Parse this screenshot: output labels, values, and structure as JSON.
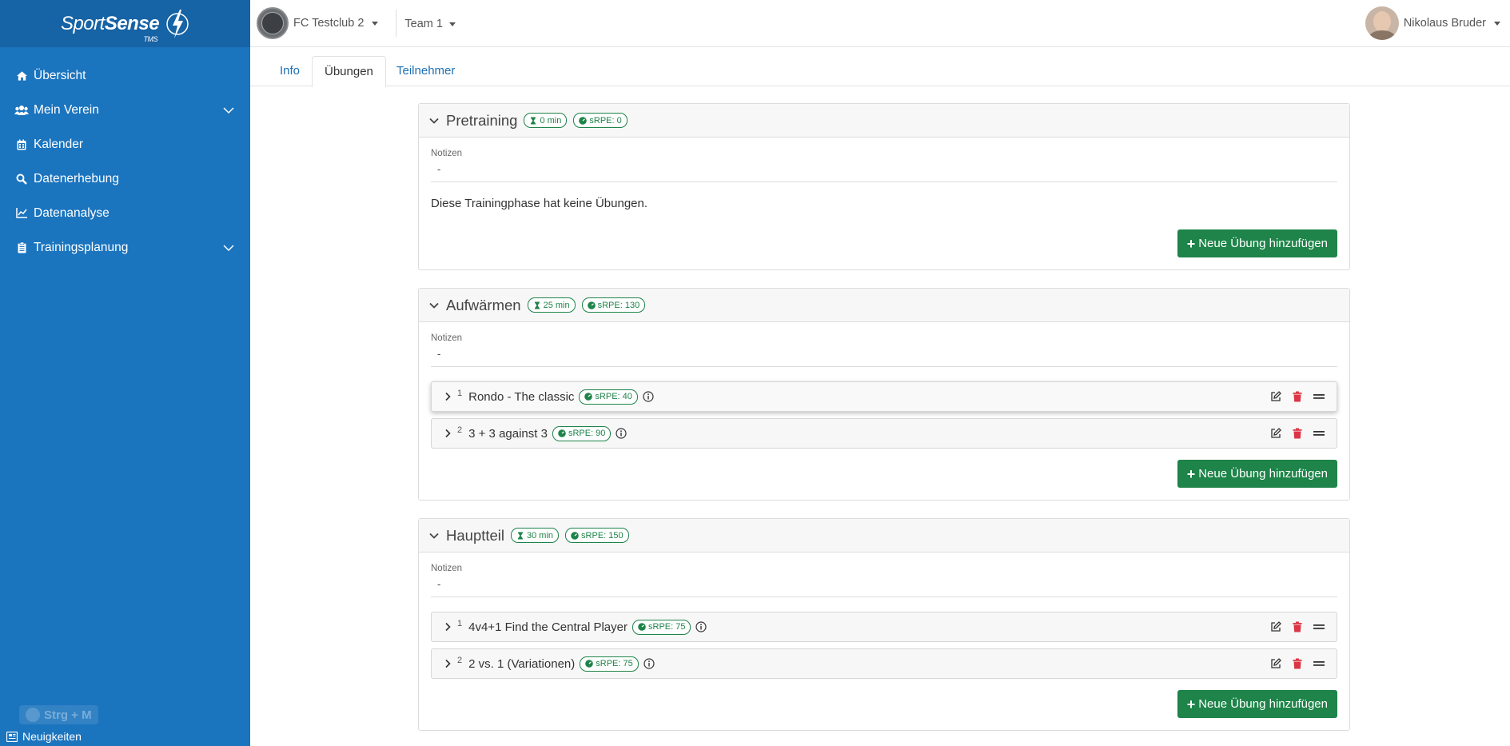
{
  "brand": {
    "name_light": "Sport",
    "name_bold": "Sense",
    "sub": "TMS"
  },
  "sidebar": {
    "items": [
      {
        "label": "Übersicht",
        "icon": "home-icon"
      },
      {
        "label": "Mein Verein",
        "icon": "users-icon",
        "expandable": true
      },
      {
        "label": "Kalender",
        "icon": "calendar-icon"
      },
      {
        "label": "Datenerhebung",
        "icon": "search-icon"
      },
      {
        "label": "Datenanalyse",
        "icon": "chart-icon"
      },
      {
        "label": "Trainingsplanung",
        "icon": "clipboard-icon",
        "expandable": true
      }
    ],
    "shortcut": "Strg + M",
    "news": "Neuigkeiten"
  },
  "header": {
    "club": "FC Testclub 2",
    "team": "Team 1",
    "user": "Nikolaus Bruder"
  },
  "tabs": [
    {
      "label": "Info",
      "active": false
    },
    {
      "label": "Übungen",
      "active": true
    },
    {
      "label": "Teilnehmer",
      "active": false
    }
  ],
  "phases": [
    {
      "title": "Pretraining",
      "duration": "0 min",
      "srpe": "sRPE: 0",
      "notes_label": "Notizen",
      "notes": "-",
      "empty_text": "Diese Trainingphase hat keine Übungen.",
      "exercises": [],
      "add_label": "Neue Übung hinzufügen"
    },
    {
      "title": "Aufwärmen",
      "duration": "25 min",
      "srpe": "sRPE: 130",
      "notes_label": "Notizen",
      "notes": "-",
      "exercises": [
        {
          "num": "1",
          "name": "Rondo - The classic",
          "srpe": "sRPE: 40"
        },
        {
          "num": "2",
          "name": "3 + 3 against 3",
          "srpe": "sRPE: 90"
        }
      ],
      "add_label": "Neue Übung hinzufügen"
    },
    {
      "title": "Hauptteil",
      "duration": "30 min",
      "srpe": "sRPE: 150",
      "notes_label": "Notizen",
      "notes": "-",
      "exercises": [
        {
          "num": "1",
          "name": "4v4+1 Find the Central Player",
          "srpe": "sRPE: 75"
        },
        {
          "num": "2",
          "name": "2 vs. 1 (Variationen)",
          "srpe": "sRPE: 75"
        }
      ],
      "add_label": "Neue Übung hinzufügen"
    }
  ],
  "colors": {
    "sidebar": "#1b74be",
    "brand_bar": "#1663a5",
    "accent_green": "#1e8449",
    "delete_red": "#dc3545",
    "link_blue": "#1d6fb3"
  }
}
